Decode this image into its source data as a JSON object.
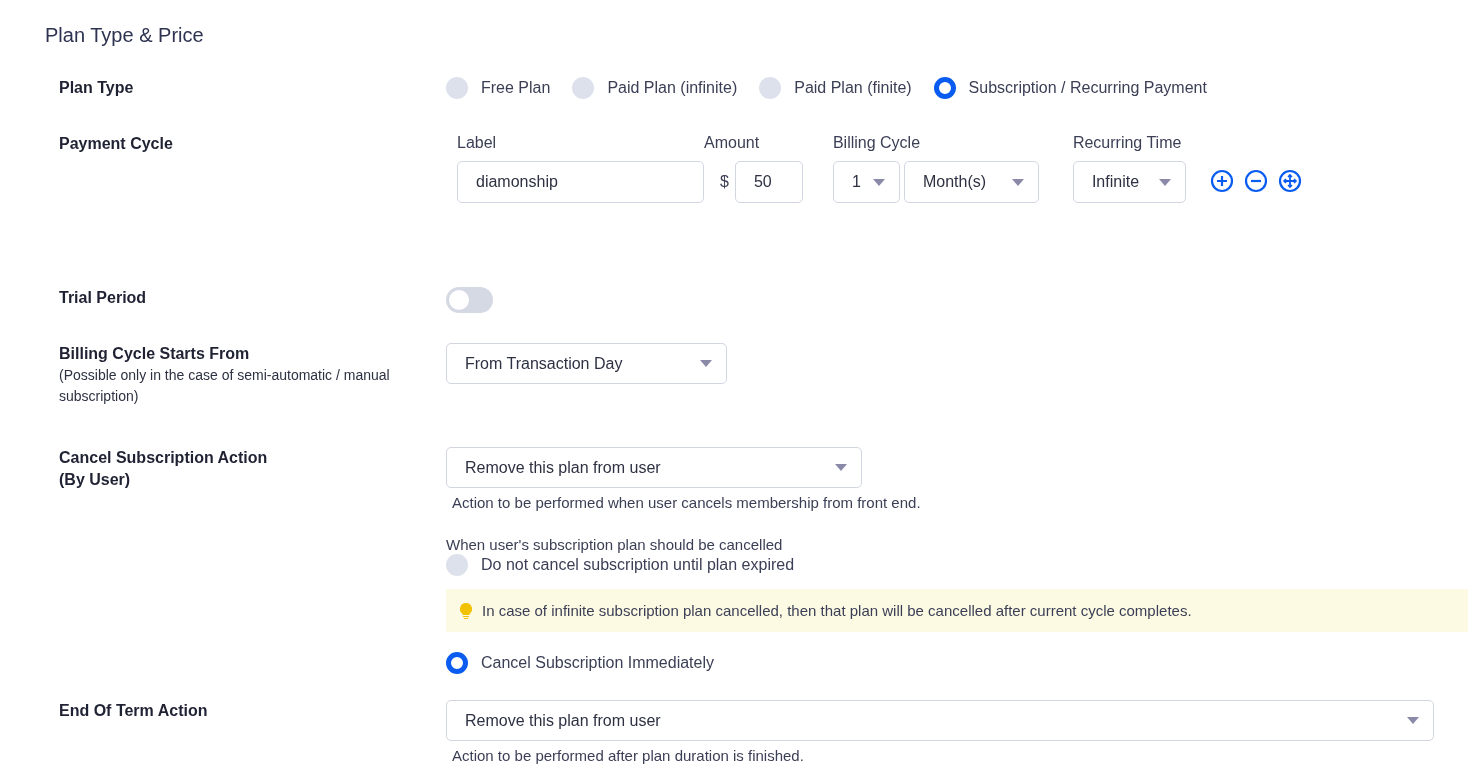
{
  "title": "Plan Type & Price",
  "plan_type": {
    "label": "Plan Type",
    "options": [
      {
        "label": "Free Plan",
        "selected": false
      },
      {
        "label": "Paid Plan (infinite)",
        "selected": false
      },
      {
        "label": "Paid Plan (finite)",
        "selected": false
      },
      {
        "label": "Subscription / Recurring Payment",
        "selected": true
      }
    ]
  },
  "payment_cycle": {
    "label": "Payment Cycle",
    "label_heading": "Label",
    "label_value": "diamonship",
    "amount_heading": "Amount",
    "currency": "$",
    "amount": "50",
    "billing_heading": "Billing Cycle",
    "billing_count": "1",
    "billing_unit": "Month(s)",
    "recurring_heading": "Recurring Time",
    "recurring": "Infinite"
  },
  "trial_period": {
    "label": "Trial Period",
    "on": false
  },
  "billing_start": {
    "label": "Billing Cycle Starts From",
    "note": "(Possible only in the case of semi-automatic / manual subscription)",
    "value": "From Transaction Day"
  },
  "cancel_action": {
    "label": "Cancel Subscription Action",
    "sublabel": "(By User)",
    "value": "Remove this plan from user",
    "help": "Action to be performed when user cancels membership from front end.",
    "when_label": "When user's subscription plan should be cancelled",
    "options": [
      {
        "label": "Do not cancel subscription until plan expired",
        "selected": false,
        "tip": "In case of infinite subscription plan cancelled, then that plan will be cancelled after current cycle completes."
      },
      {
        "label": "Cancel Subscription Immediately",
        "selected": true
      }
    ]
  },
  "end_of_term": {
    "label": "End Of Term Action",
    "value": "Remove this plan from user",
    "help": "Action to be performed after plan duration is finished."
  }
}
